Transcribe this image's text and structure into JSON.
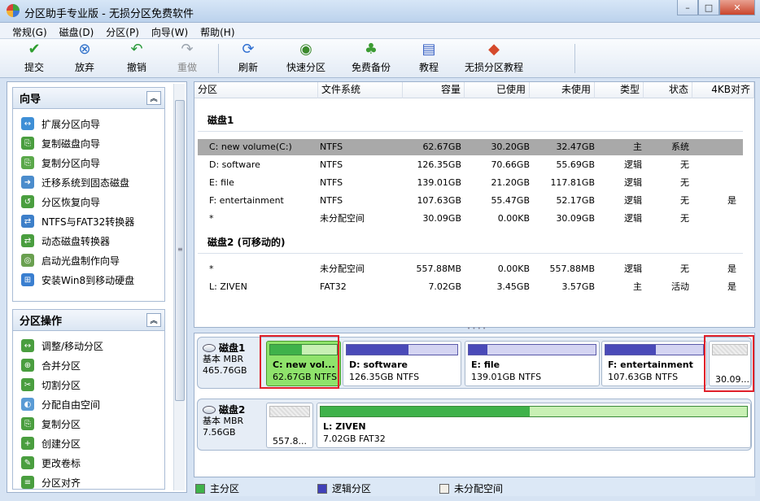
{
  "window": {
    "title": "分区助手专业版 - 无损分区免费软件",
    "min": "–",
    "max": "□",
    "close": "✕"
  },
  "menu": [
    "常规(G)",
    "磁盘(D)",
    "分区(P)",
    "向导(W)",
    "帮助(H)"
  ],
  "toolbar": [
    {
      "label": "提交",
      "icon": "check-icon",
      "glyph": "✔",
      "color": "#2f9e2f",
      "enabled": true
    },
    {
      "label": "放弃",
      "icon": "discard-icon",
      "glyph": "⊗",
      "color": "#2d6fc9",
      "enabled": true
    },
    {
      "label": "撤销",
      "icon": "undo-icon",
      "glyph": "↶",
      "color": "#2a9a3a",
      "enabled": true
    },
    {
      "label": "重做",
      "icon": "redo-icon",
      "glyph": "↷",
      "color": "#9aa3ad",
      "enabled": false
    },
    {
      "label": "刷新",
      "icon": "refresh-icon",
      "glyph": "⟳",
      "color": "#2f6fd1",
      "enabled": true
    },
    {
      "label": "快速分区",
      "icon": "quick-partition-icon",
      "glyph": "◉",
      "color": "#3b8a2c",
      "enabled": true
    },
    {
      "label": "免费备份",
      "icon": "backup-icon",
      "glyph": "♣",
      "color": "#3c9c33",
      "enabled": true
    },
    {
      "label": "教程",
      "icon": "tutorial-icon",
      "glyph": "▤",
      "color": "#3a62c4",
      "enabled": true
    },
    {
      "label": "无损分区教程",
      "icon": "lossless-tutorial-icon",
      "glyph": "◆",
      "color": "#d54a2c",
      "enabled": true
    }
  ],
  "wizard": {
    "title": "向导",
    "collapse": "︽",
    "items": [
      {
        "label": "扩展分区向导",
        "icon": "extend-wizard-icon",
        "color": "#3f8fd6",
        "glyph": "↔"
      },
      {
        "label": "复制磁盘向导",
        "icon": "copy-disk-icon",
        "color": "#4a9e3f",
        "glyph": "⎘"
      },
      {
        "label": "复制分区向导",
        "icon": "copy-partition-icon",
        "color": "#5aa84a",
        "glyph": "⎘"
      },
      {
        "label": "迁移系统到固态磁盘",
        "icon": "migrate-ssd-icon",
        "color": "#4b8ccc",
        "glyph": "➜"
      },
      {
        "label": "分区恢复向导",
        "icon": "recovery-icon",
        "color": "#4a9e3f",
        "glyph": "↺"
      },
      {
        "label": "NTFS与FAT32转换器",
        "icon": "ntfs-fat32-icon",
        "color": "#3d7fc9",
        "glyph": "⇄"
      },
      {
        "label": "动态磁盘转换器",
        "icon": "dynamic-disk-icon",
        "color": "#4a9e3f",
        "glyph": "⇄"
      },
      {
        "label": "启动光盘制作向导",
        "icon": "bootable-cd-icon",
        "color": "#6aa050",
        "glyph": "◎"
      },
      {
        "label": "安装Win8到移动硬盘",
        "icon": "win8-to-go-icon",
        "color": "#3a7fd0",
        "glyph": "⊞"
      }
    ]
  },
  "ops": {
    "title": "分区操作",
    "collapse": "︽",
    "items": [
      {
        "label": "调整/移动分区",
        "icon": "resize-move-icon",
        "color": "#4a9e3f",
        "glyph": "↔"
      },
      {
        "label": "合并分区",
        "icon": "merge-icon",
        "color": "#4a9e3f",
        "glyph": "⊕"
      },
      {
        "label": "切割分区",
        "icon": "split-icon",
        "color": "#4a9e3f",
        "glyph": "✂"
      },
      {
        "label": "分配自由空间",
        "icon": "allocate-space-icon",
        "color": "#5a9bd5",
        "glyph": "◐"
      },
      {
        "label": "复制分区",
        "icon": "copy-icon",
        "color": "#4a9e3f",
        "glyph": "⎘"
      },
      {
        "label": "创建分区",
        "icon": "create-icon",
        "color": "#4a9e3f",
        "glyph": "+"
      },
      {
        "label": "更改卷标",
        "icon": "label-icon",
        "color": "#4a9e3f",
        "glyph": "✎"
      },
      {
        "label": "分区对齐",
        "icon": "align-icon",
        "color": "#4a9e3f",
        "glyph": "≡"
      }
    ]
  },
  "columns": [
    "分区",
    "文件系统",
    "容量",
    "已使用",
    "未使用",
    "类型",
    "状态",
    "4KB对齐"
  ],
  "disks": [
    {
      "title": "磁盘1",
      "rows": [
        {
          "name": "C: new volume(C:)",
          "fs": "NTFS",
          "cap": "62.67GB",
          "used": "30.20GB",
          "free": "32.47GB",
          "type": "主",
          "status": "系统",
          "align": "",
          "selected": true
        },
        {
          "name": "D: software",
          "fs": "NTFS",
          "cap": "126.35GB",
          "used": "70.66GB",
          "free": "55.69GB",
          "type": "逻辑",
          "status": "无",
          "align": ""
        },
        {
          "name": "E: file",
          "fs": "NTFS",
          "cap": "139.01GB",
          "used": "21.20GB",
          "free": "117.81GB",
          "type": "逻辑",
          "status": "无",
          "align": ""
        },
        {
          "name": "F: entertainment",
          "fs": "NTFS",
          "cap": "107.63GB",
          "used": "55.47GB",
          "free": "52.17GB",
          "type": "逻辑",
          "status": "无",
          "align": "是"
        },
        {
          "name": "*",
          "fs": "未分配空间",
          "cap": "30.09GB",
          "used": "0.00KB",
          "free": "30.09GB",
          "type": "逻辑",
          "status": "无",
          "align": ""
        }
      ]
    },
    {
      "title": "磁盘2 (可移动的)",
      "rows": [
        {
          "name": "*",
          "fs": "未分配空间",
          "cap": "557.88MB",
          "used": "0.00KB",
          "free": "557.88MB",
          "type": "逻辑",
          "status": "无",
          "align": "是"
        },
        {
          "name": "L: ZIVEN",
          "fs": "FAT32",
          "cap": "7.02GB",
          "used": "3.45GB",
          "free": "3.57GB",
          "type": "主",
          "status": "活动",
          "align": "是"
        }
      ]
    }
  ],
  "diskmap": [
    {
      "name": "磁盘1",
      "style": "基本 MBR",
      "size": "465.76GB",
      "parts": [
        {
          "name": "C: new vol...",
          "size": "62.67GB NTFS",
          "used_fraction": 0.48,
          "kind": "primary",
          "selected": true
        },
        {
          "name": "D: software",
          "size": "126.35GB NTFS",
          "used_fraction": 0.56,
          "kind": "logical"
        },
        {
          "name": "E: file",
          "size": "139.01GB NTFS",
          "used_fraction": 0.15,
          "kind": "logical"
        },
        {
          "name": "F: entertainment",
          "size": "107.63GB NTFS",
          "used_fraction": 0.52,
          "kind": "logical"
        },
        {
          "name": "",
          "size": "30.09...",
          "used_fraction": 0,
          "kind": "unallocated"
        }
      ]
    },
    {
      "name": "磁盘2",
      "style": "基本 MBR",
      "size": "7.56GB",
      "parts": [
        {
          "name": "",
          "size": "557.8...",
          "used_fraction": 0,
          "kind": "unallocated"
        },
        {
          "name": "L: ZIVEN",
          "size": "7.02GB FAT32",
          "used_fraction": 0.49,
          "kind": "primary"
        }
      ]
    }
  ],
  "legend": [
    {
      "label": "主分区",
      "color": "#3fb24a"
    },
    {
      "label": "逻辑分区",
      "color": "#4141b8"
    },
    {
      "label": "未分配空间",
      "color": "#f2efe8"
    }
  ],
  "colors": {
    "primary": "#3fb24a",
    "primary_light": "#c8f0b4",
    "logical": "#4a4ab8",
    "logical_light": "#d4d4f2",
    "selected": "#8fe36b"
  }
}
